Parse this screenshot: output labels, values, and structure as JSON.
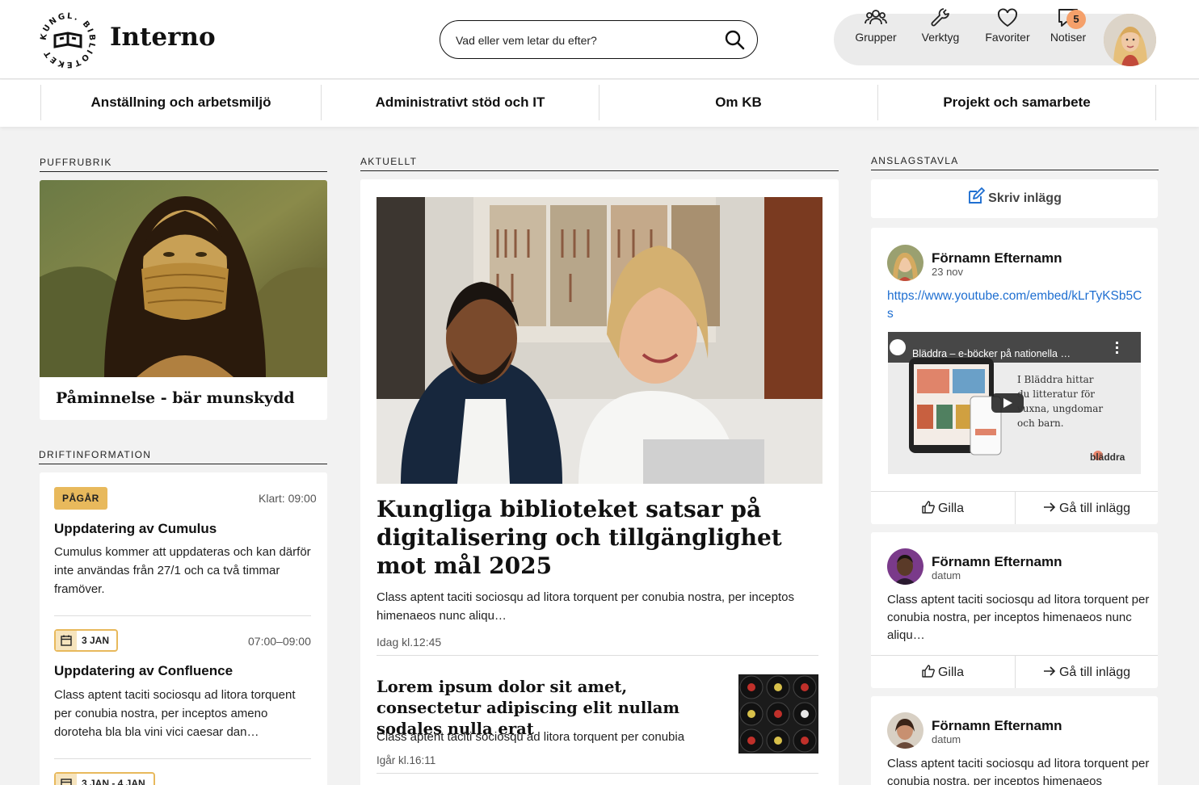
{
  "header": {
    "brand": "Interno",
    "logo_text": "KUNGL. BIBLIOTEKET",
    "search": {
      "placeholder": "Vad eller vem letar du efter?"
    },
    "actions": [
      {
        "label": "Grupper",
        "icon": "groups-icon"
      },
      {
        "label": "Verktyg",
        "icon": "wrench-icon"
      },
      {
        "label": "Favoriter",
        "icon": "heart-icon"
      },
      {
        "label": "Notiser",
        "icon": "chat-bubble-icon"
      }
    ],
    "notification_count": "5"
  },
  "nav": {
    "items": [
      "Anställning och arbetsmiljö",
      "Administrativt stöd och IT",
      "Om KB",
      "Projekt och samarbete"
    ]
  },
  "left": {
    "puff_label": "PUFFRUBRIK",
    "puff_title": "Påminnelse - bär munskydd",
    "drift_label": "DRIFTINFORMATION",
    "drift_items": [
      {
        "badge": "PÅGÅR",
        "time": "Klart: 09:00",
        "title": "Uppdatering av Cumulus",
        "text": "Cumulus kommer att uppdateras och kan därför inte användas från 27/1 och ca två timmar framöver."
      },
      {
        "badge": "3 JAN",
        "time": "07:00–09:00",
        "title": "Uppdatering av Confluence",
        "text": "Class aptent taciti sociosqu ad litora torquent per conubia nostra, per inceptos ameno doroteha bla bla vini vici caesar dan…"
      },
      {
        "badge": "3 JAN - 4 JAN"
      }
    ]
  },
  "center": {
    "label": "AKTUELLT",
    "main_article": {
      "title": "Kungliga biblioteket satsar på digitalisering och tillgänglighet mot mål 2025",
      "excerpt": "Class aptent taciti sociosqu ad litora torquent per conubia nostra, per inceptos himenaeos nunc aliqu…",
      "time": "Idag kl.12:45"
    },
    "article2": {
      "title": "Lorem ipsum dolor sit amet, consectetur adipiscing elit nullam sodales nulla erat",
      "excerpt": "Class aptent taciti sociosqu ad litora torquent per conubia",
      "time": "Igår kl.16:11"
    }
  },
  "right": {
    "label": "ANSLAGSTAVLA",
    "write_label": "Skriv inlägg",
    "like_label": "Gilla",
    "goto_label": "Gå till inlägg",
    "posts": [
      {
        "name": "Förnamn Efternamn",
        "date": "23 nov",
        "link": "https://www.youtube.com/embed/kLrTyKSb5Cs",
        "video_title": "Bläddra – e-böcker på nationella …",
        "video_text": "I Bläddra hittar du litteratur för vuxna, ungdomar och barn.",
        "video_logo": "bläddra"
      },
      {
        "name": "Förnamn Efternamn",
        "date": "datum",
        "text": "Class aptent taciti sociosqu ad litora torquent per conubia nostra, per inceptos himenaeos nunc aliqu…"
      },
      {
        "name": "Förnamn Efternamn",
        "date": "datum",
        "text": "Class aptent taciti sociosqu ad litora torquent per conubia nostra, per inceptos himenaeos"
      }
    ]
  },
  "colors": {
    "accent_yellow": "#e8b95c",
    "link_blue": "#1f6fd1",
    "badge_orange": "#f5a06a"
  }
}
